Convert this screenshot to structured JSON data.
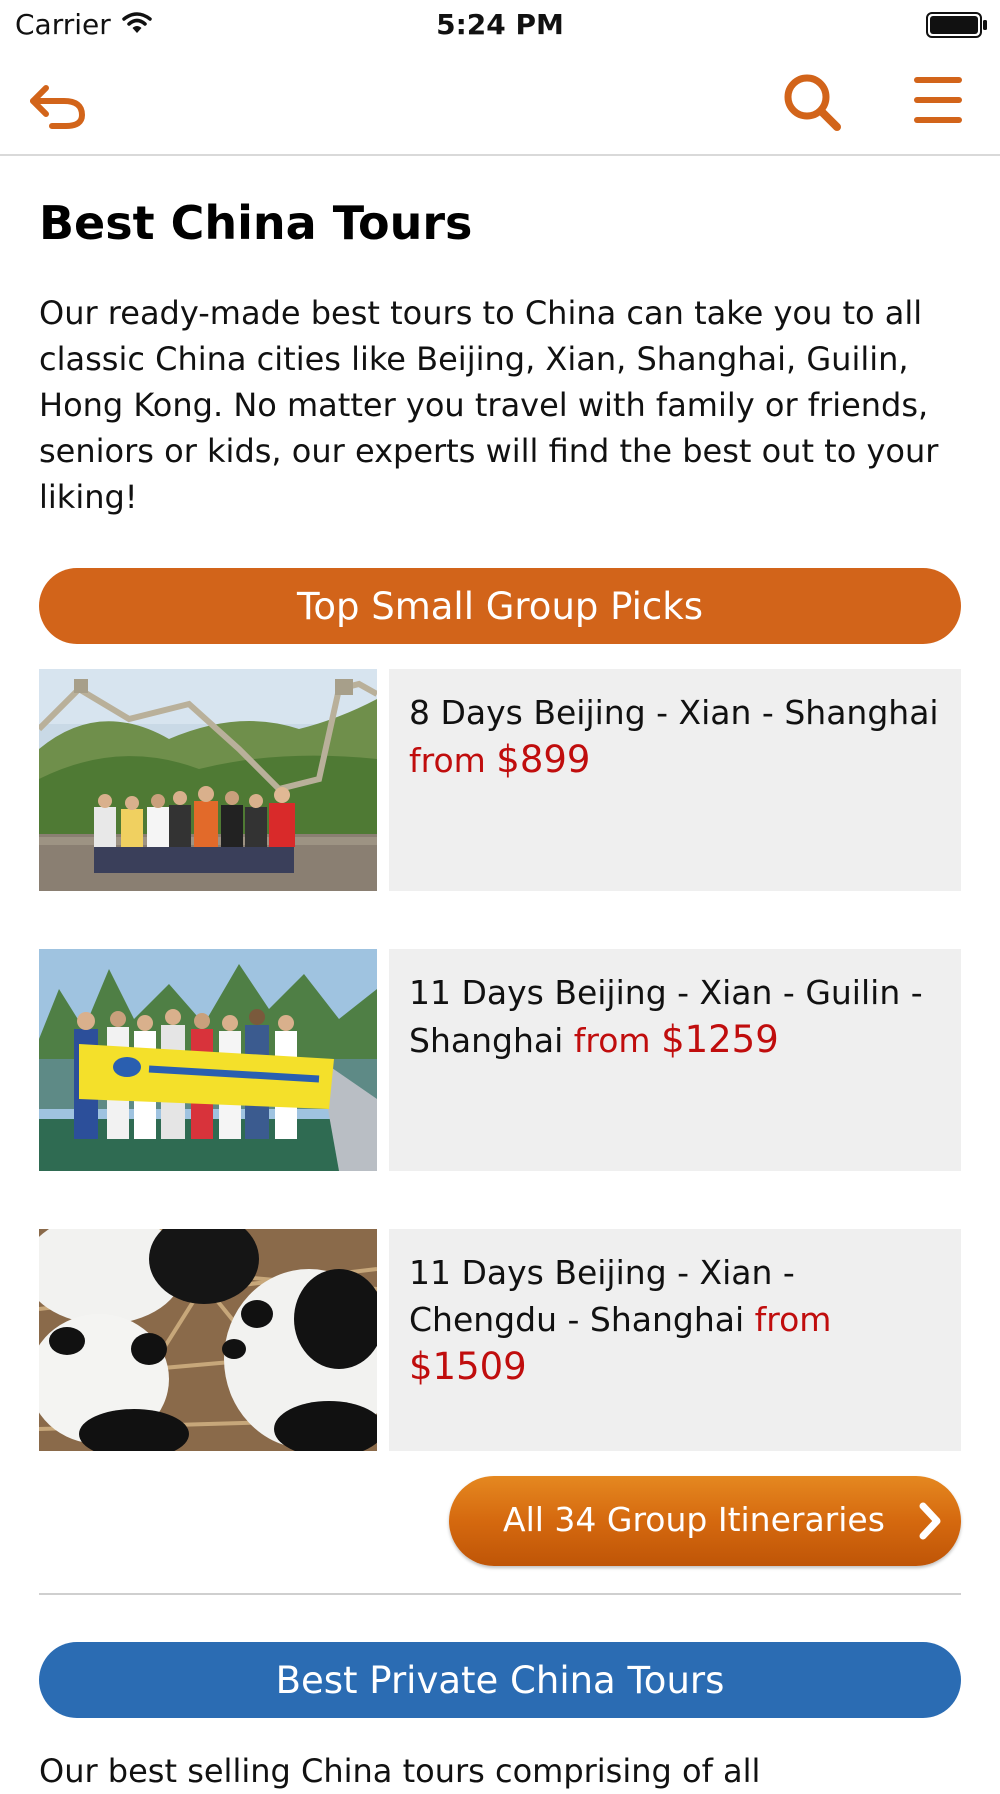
{
  "status_bar": {
    "carrier": "Carrier",
    "time": "5:24 PM"
  },
  "nav": {
    "icons": [
      "back-icon",
      "search-icon",
      "menu-icon"
    ],
    "accent": "#d2641a"
  },
  "page": {
    "title": "Best China Tours",
    "intro": "Our ready-made best tours to China can take you to all classic China cities like Beijing, Xian, Shanghai, Guilin, Hong Kong. No matter you travel with family or friends, seniors or kids, our experts will find the best out to your liking!"
  },
  "group_section": {
    "header": "Top Small Group Picks",
    "header_color": "#d2641a",
    "tours": [
      {
        "title": "8 Days Beijing - Xian - Shanghai",
        "from": "from",
        "price": "$899"
      },
      {
        "title": "11 Days Beijing - Xian - Guilin - Shanghai",
        "from": "from",
        "price": "$1259"
      },
      {
        "title": "11 Days Beijing - Xian - Chengdu - Shanghai",
        "from": "from",
        "price": "$1509"
      }
    ],
    "all_button": "All 34 Group Itineraries"
  },
  "private_section": {
    "header": "Best Private China Tours",
    "header_color": "#2b6cb3",
    "intro_partial": "Our best selling China tours comprising of all"
  },
  "colors": {
    "price": "#c00d0d",
    "card_bg": "#efefef"
  }
}
